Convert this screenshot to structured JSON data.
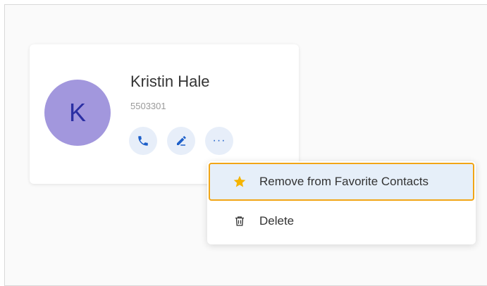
{
  "contact": {
    "avatar_initial": "K",
    "name": "Kristin Hale",
    "number": "5503301"
  },
  "actions": [
    {
      "name": "call",
      "icon": "phone-icon"
    },
    {
      "name": "edit",
      "icon": "pencil-icon"
    },
    {
      "name": "more",
      "icon": "ellipsis-icon",
      "label": "···"
    }
  ],
  "menu": {
    "items": [
      {
        "label": "Remove from Favorite Contacts",
        "icon": "star-icon",
        "highlighted": true
      },
      {
        "label": "Delete",
        "icon": "trash-icon",
        "highlighted": false
      }
    ]
  },
  "colors": {
    "avatar_bg": "#a297dd",
    "avatar_text": "#2b2fa3",
    "action_bg": "#e7eef9",
    "action_icon": "#1d5fc9",
    "highlight_border": "#f1a516",
    "highlight_bg": "#e6eff9",
    "star": "#f5b400"
  }
}
